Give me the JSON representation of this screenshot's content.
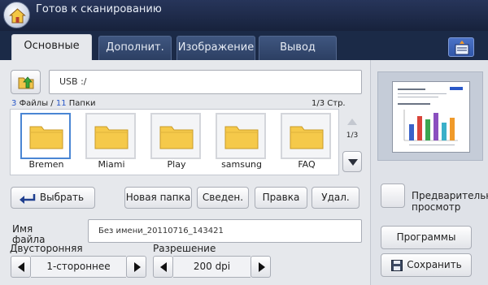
{
  "header": {
    "status_title": "Готов к сканированию"
  },
  "tabs": [
    {
      "label": "Основные",
      "active": true
    },
    {
      "label": "Дополнит.",
      "active": false
    },
    {
      "label": "Изображение",
      "active": false
    },
    {
      "label": "Вывод",
      "active": false
    }
  ],
  "browser": {
    "path": "USB :/",
    "files_count": "3",
    "files_label": "Файлы",
    "folders_sep": "/",
    "folders_count": "11",
    "folders_label": "Папки",
    "page_indicator": "1/3 Стр.",
    "scroll_indicator": "1/3",
    "items": [
      {
        "name": "Bremen",
        "selected": true
      },
      {
        "name": "Miami",
        "selected": false
      },
      {
        "name": "Play",
        "selected": false
      },
      {
        "name": "samsung",
        "selected": false
      },
      {
        "name": "FAQ",
        "selected": false
      }
    ]
  },
  "actions": {
    "select": "Выбрать",
    "new_folder": "Новая папка",
    "info": "Сведен.",
    "edit": "Правка",
    "delete": "Удал."
  },
  "filename": {
    "label": "Имя файла",
    "value": "Без имени_20110716_143421"
  },
  "duplex": {
    "label": "Двусторонняя",
    "value": "1-стороннее"
  },
  "resolution": {
    "label": "Разрешение",
    "value": "200 dpi"
  },
  "side": {
    "preview_label": "Предварительный просмотр",
    "programs": "Программы",
    "save": "Сохранить"
  },
  "colors": {
    "accent": "#2a58c8",
    "folder": "#f5c94a",
    "selection": "#4a86d4"
  }
}
